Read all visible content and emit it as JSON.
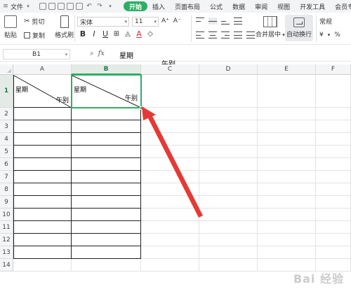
{
  "menubar": {
    "file_label": "文件",
    "tabs": [
      {
        "label": "开始",
        "active": true
      },
      {
        "label": "插入",
        "active": false
      },
      {
        "label": "页面布局",
        "active": false
      },
      {
        "label": "公式",
        "active": false
      },
      {
        "label": "数据",
        "active": false
      },
      {
        "label": "审阅",
        "active": false
      },
      {
        "label": "视图",
        "active": false
      },
      {
        "label": "开发工具",
        "active": false
      },
      {
        "label": "会员专",
        "active": false
      }
    ]
  },
  "ribbon": {
    "paste_label": "粘贴",
    "cut_label": "剪切",
    "copy_label": "复制",
    "format_painter_label": "格式刷",
    "font_name": "宋体",
    "font_size": "11",
    "bold": "B",
    "italic": "I",
    "underline": "U",
    "merge_center_label": "合并居中",
    "wrap_text_label": "自动换行",
    "number_format": "常规",
    "currency_symbol": "¥",
    "percent_symbol": "%"
  },
  "formula_bar": {
    "name_box": "B1",
    "fx_label": "fx",
    "content_line1": "星期",
    "content_line2": "午别"
  },
  "grid": {
    "columns": [
      "A",
      "B",
      "C",
      "D",
      "E",
      "F"
    ],
    "rows": [
      "1",
      "2",
      "3",
      "4",
      "5",
      "6",
      "7",
      "8",
      "9",
      "10",
      "11",
      "12",
      "13",
      "14"
    ],
    "selected_column": "B",
    "selected_row": "1",
    "a1_top_left": "星期",
    "a1_bottom_right": "午别",
    "b1_top_left": "星期",
    "b1_bottom_right": "午别"
  },
  "annotation": {
    "arrow_color": "#e53935"
  },
  "watermark": {
    "text": "Bai 经验"
  },
  "colors": {
    "accent": "#2dae66"
  }
}
